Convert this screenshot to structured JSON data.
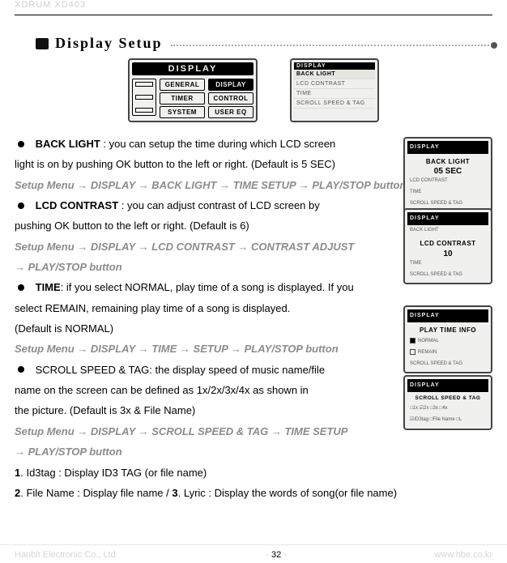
{
  "header": {
    "model": "XDRUM XD403"
  },
  "section": {
    "icon": "monitor-icon",
    "title": "Display Setup"
  },
  "fig_main": {
    "title": "DISPLAY",
    "menu": [
      "GENERAL",
      "DISPLAY",
      "TIMER",
      "CONTROL",
      "SYSTEM",
      "USER EQ"
    ],
    "selected": "DISPLAY"
  },
  "fig_list": {
    "hdr": "DISPLAY",
    "rows": [
      "BACK LIGHT",
      "LCD CONTRAST",
      "TIME",
      "SCROLL SPEED & TAG"
    ]
  },
  "bullets": {
    "b1_title": "BACK LIGHT",
    "b1_rest": " : you can setup the time during which LCD screen",
    "b1_l2": "light is on by pushing OK button to the left or right. (Default is 5 SEC)",
    "b1_path": "Setup Menu → DISPLAY → BACK LIGHT → TIME SETUP → PLAY/STOP button",
    "b2_title": "LCD CONTRAST",
    "b2_rest": " : you can adjust contrast of LCD screen by",
    "b2_l2": "pushing OK button to the left or right. (Default is 6)",
    "b2_path_a": "Setup Menu → DISPLAY → LCD CONTRAST → CONTRAST ADJUST",
    "b2_path_b": "→ PLAY/STOP button",
    "b3_title": "TIME",
    "b3_rest": ": if you select NORMAL, play time of a song is displayed. If you",
    "b3_l2": "select REMAIN, remaining play time of a song is displayed.",
    "b3_l3": "(Default is NORMAL)",
    "b3_path": "Setup Menu → DISPLAY → TIME → SETUP → PLAY/STOP button",
    "b4_title": "SCROLL SPEED & TAG: the display speed of music name/file",
    "b4_l2": "name on the screen can be defined as 1x/2x/3x/4x as shown in",
    "b4_l3": "the picture. (Default is 3x & File Name)",
    "b4_path_a": "Setup Menu → DISPLAY → SCROLL SPEED & TAG → TIME SETUP",
    "b4_path_b": "→ PLAY/STOP button"
  },
  "numbered": {
    "n1": "1",
    "n1_text": ". Id3tag : Display ID3 TAG (or file name)",
    "n2": "2",
    "n2_text": ". File Name : Display file name    /    ",
    "n3": "3",
    "n3_text": ". Lyric : Display the words of song(or file name)"
  },
  "side_panels": {
    "s1": {
      "hdr": "DISPLAY",
      "big1": "BACK LIGHT",
      "big2": "05 SEC",
      "rows": [
        "LCD CONTRAST",
        "TIME",
        "SCROLL SPEED & TAG"
      ]
    },
    "s2": {
      "hdr": "DISPLAY",
      "big1": "LCD CONTRAST",
      "big2": "10",
      "rows": [
        "BACK LIGHT",
        "TIME",
        "SCROLL SPEED & TAG"
      ]
    },
    "s3": {
      "hdr": "DISPLAY",
      "big1": "PLAY TIME INFO",
      "opt1": "NORMAL",
      "opt2": "REMAIN",
      "rows": [
        "SCROLL SPEED & TAG"
      ]
    },
    "s4": {
      "hdr": "DISPLAY",
      "big1": "SCROLL SPEED & TAG",
      "line1": "□1x  ☑2x  □3x  □4x",
      "line2": "☑ID3tag  □File Name  □L"
    }
  },
  "footer": {
    "left": "Hanbit Electronic Co., Ltd.",
    "page_prefix": "- ",
    "page_num": "32",
    "page_suffix": " -",
    "right": "www.hbe.co.kr"
  }
}
